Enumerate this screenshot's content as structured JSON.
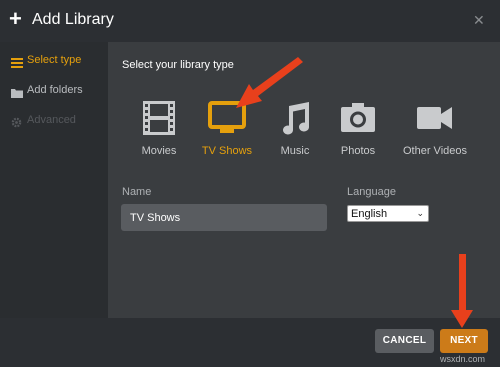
{
  "header": {
    "title": "Add Library",
    "plus_icon": "+",
    "close_icon": "✕"
  },
  "sidebar": {
    "items": [
      {
        "label": "Select type",
        "icon": "select-type-icon",
        "state": "active"
      },
      {
        "label": "Add folders",
        "icon": "folder-icon",
        "state": "normal"
      },
      {
        "label": "Advanced",
        "icon": "gear-icon",
        "state": "disabled"
      }
    ]
  },
  "main": {
    "heading": "Select your library type",
    "types": [
      {
        "label": "Movies",
        "icon": "film-icon",
        "selected": false
      },
      {
        "label": "TV Shows",
        "icon": "tv-icon",
        "selected": true
      },
      {
        "label": "Music",
        "icon": "music-note-icon",
        "selected": false
      },
      {
        "label": "Photos",
        "icon": "camera-icon",
        "selected": false
      },
      {
        "label": "Other Videos",
        "icon": "video-camera-icon",
        "selected": false
      }
    ],
    "name_label": "Name",
    "name_value": "TV Shows",
    "language_label": "Language",
    "language_value": "English"
  },
  "footer": {
    "cancel_label": "CANCEL",
    "next_label": "NEXT",
    "watermark": "wsxdn.com"
  },
  "colors": {
    "accent": "#e5a00d",
    "next_button": "#cc7b19",
    "annotation_arrow": "#e8401c"
  }
}
